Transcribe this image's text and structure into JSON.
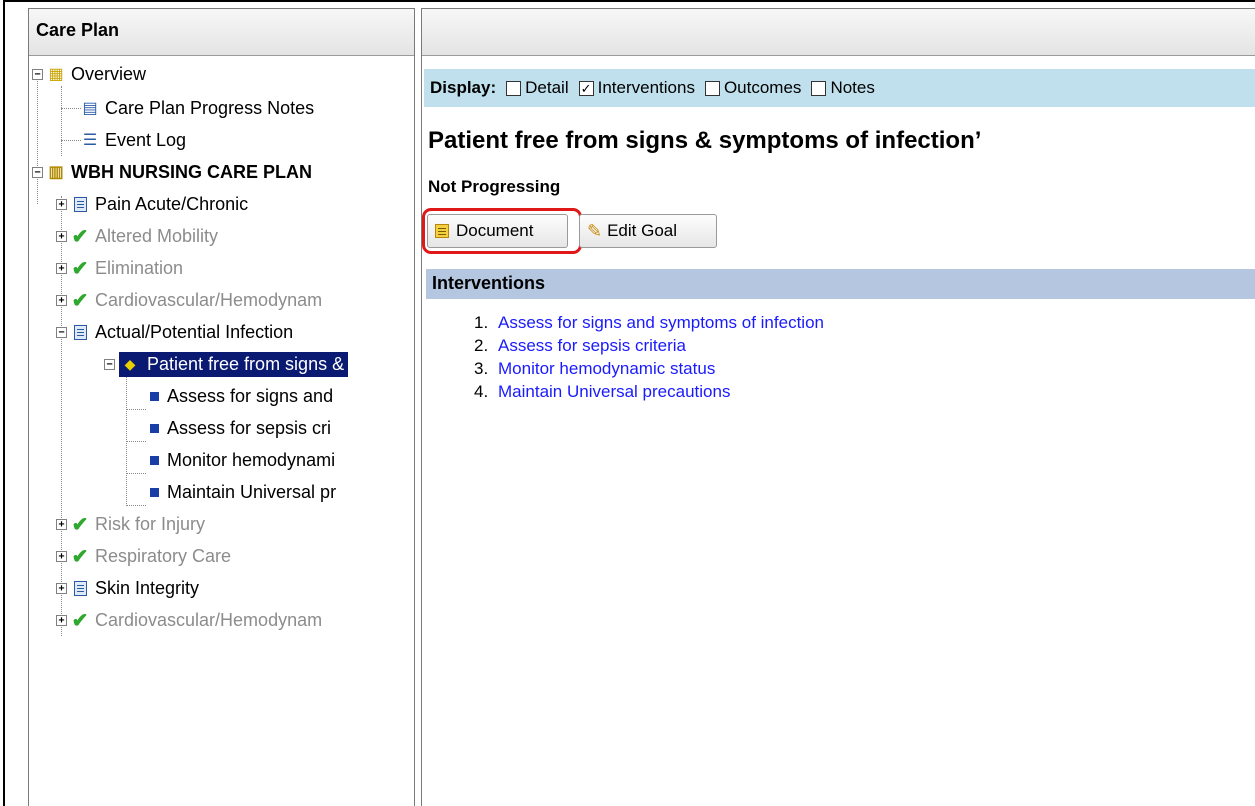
{
  "left_pane": {
    "title": "Care Plan",
    "tree": {
      "overview": "Overview",
      "progress_notes": "Care Plan Progress Notes",
      "event_log": "Event Log",
      "care_plan": "WBH NURSING CARE PLAN",
      "problems": [
        {
          "label": "Pain Acute/Chronic",
          "icon": "document-icon",
          "greyed": false
        },
        {
          "label": "Altered Mobility",
          "icon": "checkmark-icon",
          "greyed": true
        },
        {
          "label": "Elimination",
          "icon": "checkmark-icon",
          "greyed": true
        },
        {
          "label": "Cardiovascular/Hemodynam",
          "icon": "checkmark-icon",
          "greyed": true
        },
        {
          "label": "Actual/Potential Infection",
          "icon": "document-icon",
          "greyed": false
        }
      ],
      "selected_goal": "Patient free from signs &",
      "interventions": [
        "Assess for signs and",
        "Assess for sepsis cri",
        "Monitor hemodynami",
        "Maintain Universal pr"
      ],
      "more_problems": [
        {
          "label": "Risk for Injury",
          "icon": "checkmark-icon",
          "greyed": true
        },
        {
          "label": "Respiratory Care",
          "icon": "checkmark-icon",
          "greyed": true
        },
        {
          "label": "Skin Integrity",
          "icon": "document-icon",
          "greyed": false
        },
        {
          "label": "Cardiovascular/Hemodynam",
          "icon": "checkmark-icon",
          "greyed": true
        }
      ]
    }
  },
  "display_bar": {
    "label": "Display:",
    "options": [
      {
        "label": "Detail",
        "checked": false
      },
      {
        "label": "Interventions",
        "checked": true
      },
      {
        "label": "Outcomes",
        "checked": false
      },
      {
        "label": "Notes",
        "checked": false
      }
    ]
  },
  "goal": {
    "title": "Patient free from signs & symptoms of infection’",
    "status": "Not Progressing"
  },
  "buttons": {
    "document": "Document",
    "edit_goal": "Edit Goal"
  },
  "interventions_section": {
    "header": "Interventions",
    "items": [
      {
        "num": "1.",
        "text": "Assess for signs and symptoms of infection"
      },
      {
        "num": "2.",
        "text": "Assess for sepsis criteria"
      },
      {
        "num": "3.",
        "text": "Monitor hemodynamic status"
      },
      {
        "num": "4.",
        "text": "Maintain Universal precautions"
      }
    ]
  },
  "colors": {
    "selection": "#0a1a72",
    "display_bar": "#bfe0ec",
    "section_bar": "#b4c6e0",
    "link": "#1a1aff",
    "highlight": "#e01818"
  }
}
